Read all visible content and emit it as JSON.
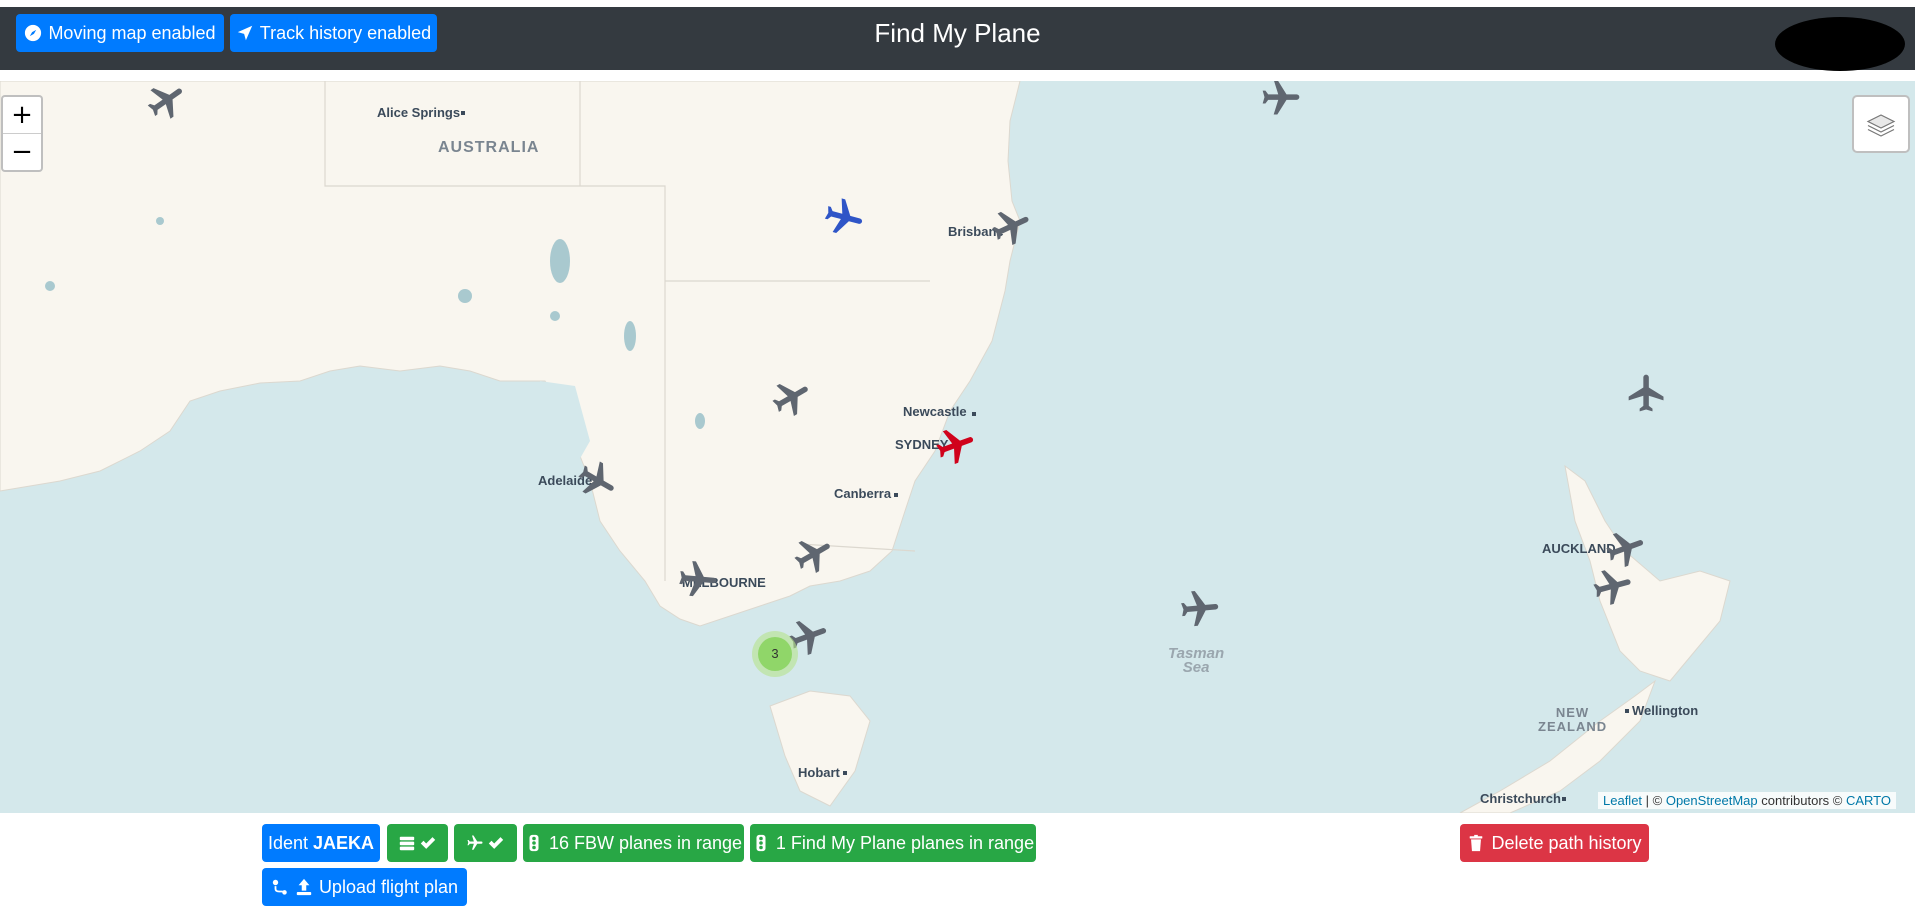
{
  "header": {
    "title": "Find My Plane",
    "moving_map_label": "Moving map enabled",
    "track_history_label": "Track history enabled"
  },
  "map": {
    "labels": {
      "alice_springs": "Alice Springs",
      "australia": "AUSTRALIA",
      "brisbane": "Brisbane",
      "newcastle": "Newcastle",
      "sydney": "SYDNEY",
      "canberra": "Canberra",
      "adelaide": "Adelaide",
      "melbourne": "MELBOURNE",
      "hobart": "Hobart",
      "tasman_sea_line1": "Tasman",
      "tasman_sea_line2": "Sea",
      "auckland": "AUCKLAND",
      "new_zealand_line1": "NEW",
      "new_zealand_line2": "ZEALAND",
      "wellington": "Wellington",
      "christchurch": "Christchurch"
    },
    "cluster_count": "3",
    "zoom_in": "+",
    "zoom_out": "−",
    "attribution": {
      "leaflet": "Leaflet",
      "separator": " | © ",
      "osm": "OpenStreetMap",
      "contributors": " contributors © ",
      "carto": "CARTO"
    },
    "colors": {
      "own_plane": "#d0021b",
      "selected_plane": "#2f55c7",
      "other_plane": "#5f6670",
      "water": "#d4e8eb",
      "land": "#f9f6ef"
    }
  },
  "footer": {
    "ident_prefix": "Ident ",
    "ident_value": "JAEKA",
    "fbw_planes": "16 FBW planes in range",
    "fmp_planes": "1 Find My Plane planes in range",
    "upload_plan": "Upload flight plan",
    "delete_history": "Delete path history"
  }
}
